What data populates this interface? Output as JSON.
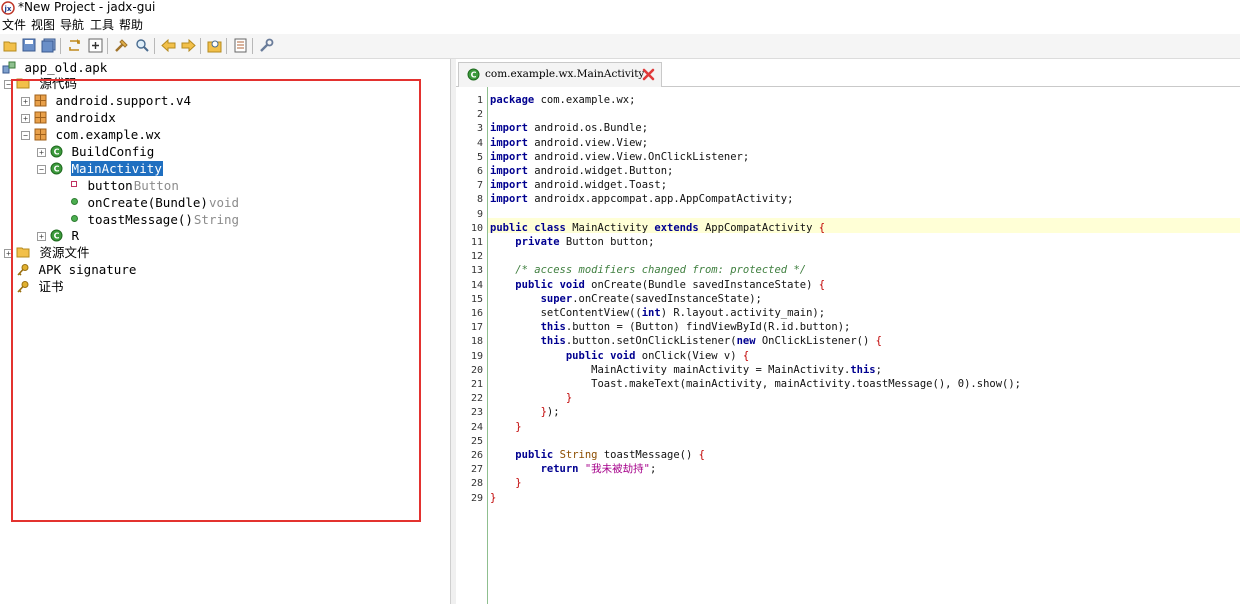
{
  "window": {
    "title": "*New Project - jadx-gui"
  },
  "menu": [
    "文件",
    "视图",
    "导航",
    "工具",
    "帮助"
  ],
  "toolbar": {
    "icons": [
      "open-folder-icon",
      "save-icon",
      "save-all-icon",
      "sync-tree-icon",
      "expand-all-icon",
      "decompile-icon",
      "search-icon",
      "back-icon",
      "forward-icon",
      "find-usage-icon",
      "log-icon",
      "preferences-icon"
    ]
  },
  "tree": {
    "root": "app_old.apk",
    "source": "源代码",
    "pkg1": "android.support.v4",
    "pkg2": "androidx",
    "pkg3": "com.example.wx",
    "cls1": "BuildConfig",
    "cls2": "MainActivity",
    "field1_name": "button",
    "field1_type": "Button",
    "method1_name": "onCreate(Bundle)",
    "method1_type": "void",
    "method2_name": "toastMessage()",
    "method2_type": "String",
    "cls3": "R",
    "resources": "资源文件",
    "signature": "APK signature",
    "cert": "证书"
  },
  "tab": {
    "label": "com.example.wx.MainActivity"
  },
  "editor": {
    "current_line": 10,
    "line_count": 29,
    "lines": [
      "package com.example.wx;",
      "",
      "import android.os.Bundle;",
      "import android.view.View;",
      "import android.view.View.OnClickListener;",
      "import android.widget.Button;",
      "import android.widget.Toast;",
      "import androidx.appcompat.app.AppCompatActivity;",
      "",
      "public class MainActivity extends AppCompatActivity {",
      "    private Button button;",
      "",
      "    /* access modifiers changed from: protected */",
      "    public void onCreate(Bundle savedInstanceState) {",
      "        super.onCreate(savedInstanceState);",
      "        setContentView((int) R.layout.activity_main);",
      "        this.button = (Button) findViewById(R.id.button);",
      "        this.button.setOnClickListener(new OnClickListener() {",
      "            public void onClick(View v) {",
      "                MainActivity mainActivity = MainActivity.this;",
      "                Toast.makeText(mainActivity, mainActivity.toastMessage(), 0).show();",
      "            }",
      "        });",
      "    }",
      "",
      "    public String toastMessage() {",
      "        return \"我未被劫持\";",
      "    }",
      "}"
    ]
  },
  "colors": {
    "selection": "#1f6fc0",
    "annotation_box": "#e3322f",
    "current_line": "#ffffd6",
    "keyword": "#000090",
    "comment": "#3f7f3f",
    "string": "#a5008a"
  }
}
